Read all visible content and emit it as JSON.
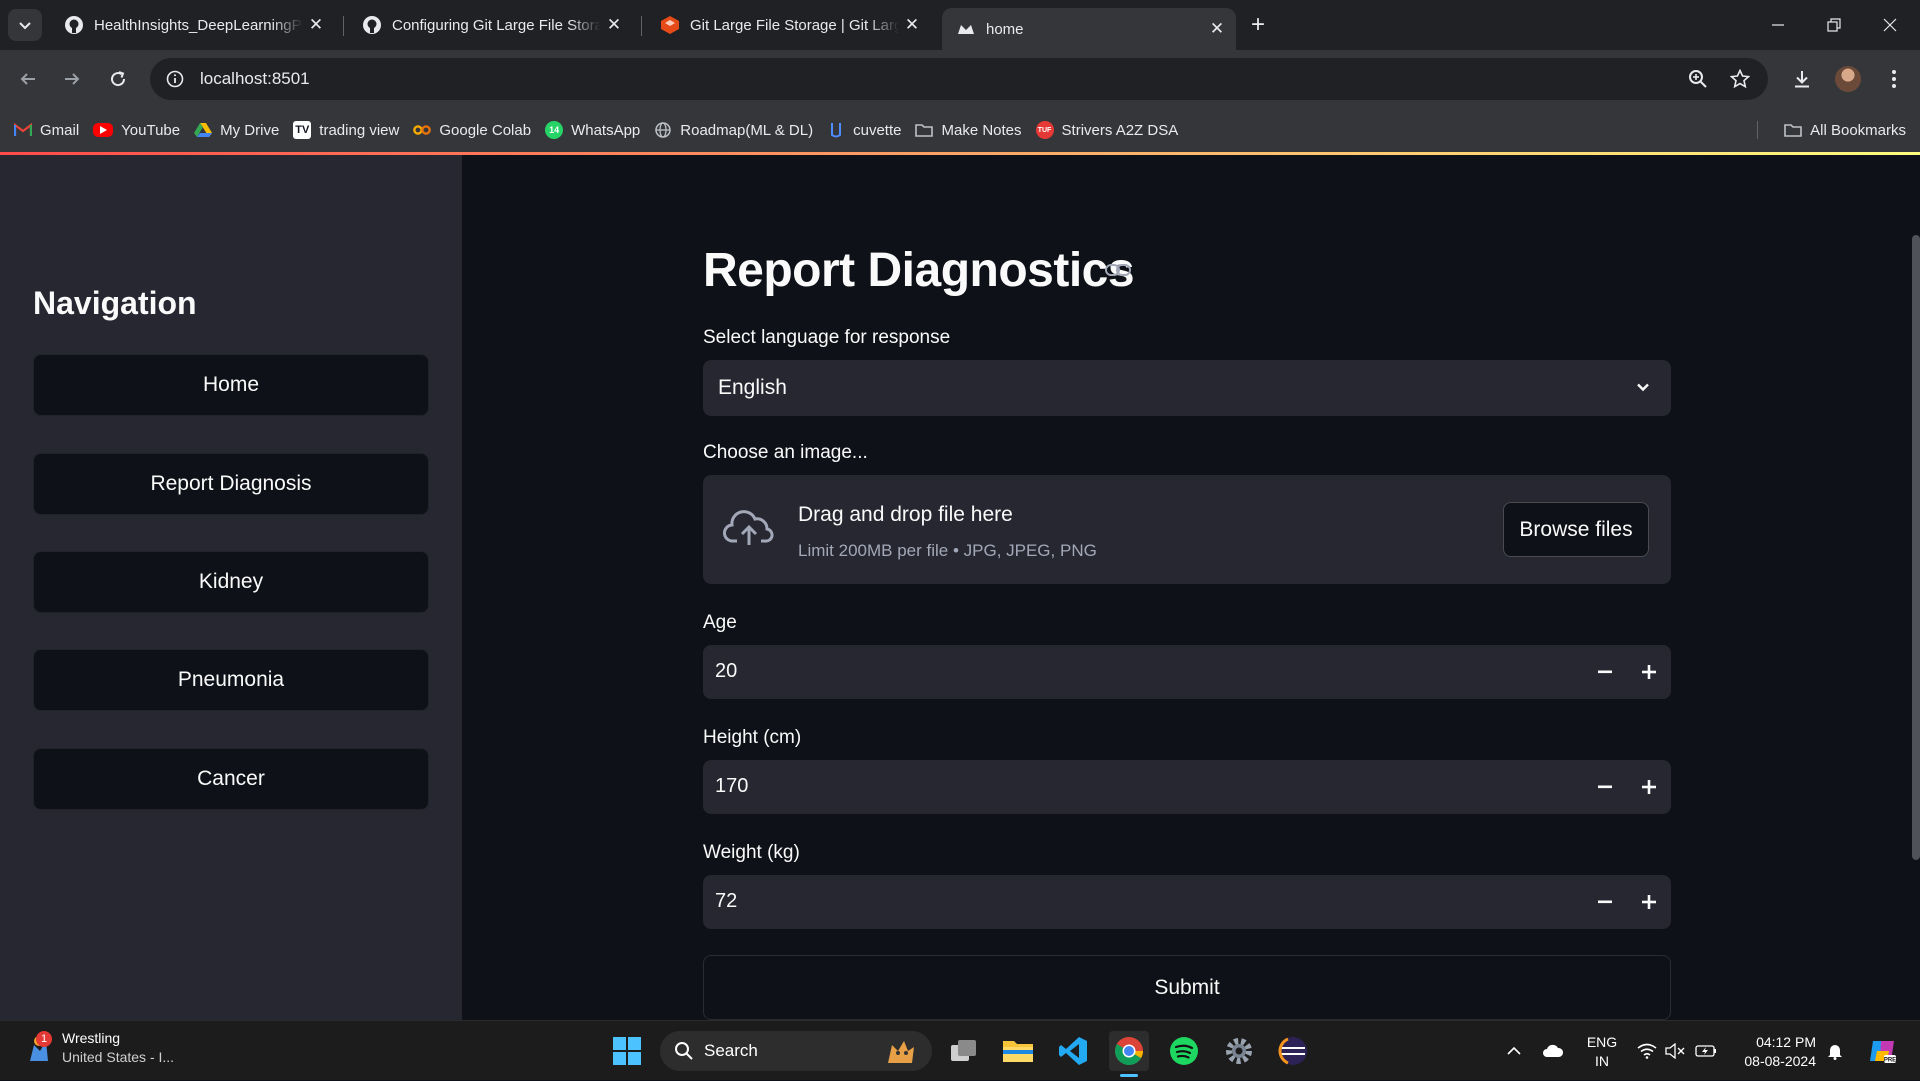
{
  "browser": {
    "tabs": [
      {
        "title": "HealthInsights_DeepLearningPr",
        "icon": "github-icon",
        "active": false
      },
      {
        "title": "Configuring Git Large File Stora",
        "icon": "github-icon",
        "active": false
      },
      {
        "title": "Git Large File Storage | Git Larg",
        "icon": "git-lfs-icon",
        "active": false
      },
      {
        "title": "home",
        "icon": "streamlit-icon",
        "active": true
      }
    ],
    "url": "localhost:8501",
    "bookmarks": [
      {
        "label": "Gmail",
        "icon": "gmail-icon",
        "color": "#ea4335"
      },
      {
        "label": "YouTube",
        "icon": "youtube-icon",
        "color": "#ff0000"
      },
      {
        "label": "My Drive",
        "icon": "drive-icon",
        "color": "#fbbc04"
      },
      {
        "label": "trading view",
        "icon": "tradingview-icon",
        "color": "#ffffff"
      },
      {
        "label": "Google Colab",
        "icon": "colab-icon",
        "color": "#f9ab00"
      },
      {
        "label": "WhatsApp",
        "icon": "whatsapp-icon",
        "color": "#25d366"
      },
      {
        "label": "Roadmap(ML &  DL)",
        "icon": "globe-icon",
        "color": "#bdc1c6"
      },
      {
        "label": "cuvette",
        "icon": "cuvette-icon",
        "color": "#4f8cff"
      },
      {
        "label": "Make Notes",
        "icon": "folder-icon",
        "color": "#bdc1c6"
      },
      {
        "label": "Strivers A2Z DSA",
        "icon": "tuf-icon",
        "color": "#e53935"
      }
    ],
    "all_bookmarks": "All Bookmarks"
  },
  "sidebar": {
    "title": "Navigation",
    "items": [
      {
        "label": "Home"
      },
      {
        "label": "Report Diagnosis"
      },
      {
        "label": "Kidney"
      },
      {
        "label": "Pneumonia"
      },
      {
        "label": "Cancer"
      }
    ]
  },
  "main": {
    "title": "Report Diagnostics",
    "language": {
      "label": "Select language for response",
      "value": "English"
    },
    "uploader": {
      "label": "Choose an image...",
      "drop_text": "Drag and drop file here",
      "limit_text": "Limit 200MB per file • JPG, JPEG, PNG",
      "browse_label": "Browse files"
    },
    "age": {
      "label": "Age",
      "value": "20"
    },
    "height": {
      "label": "Height (cm)",
      "value": "170"
    },
    "weight": {
      "label": "Weight (kg)",
      "value": "72"
    },
    "submit_label": "Submit"
  },
  "taskbar": {
    "weather_title": "Wrestling",
    "weather_sub": "United States - I...",
    "weather_badge": "1",
    "search_placeholder": "Search",
    "lang_line1": "ENG",
    "lang_line2": "IN",
    "time": "04:12 PM",
    "date": "08-08-2024"
  },
  "colors": {
    "app_bg": "#0e1117",
    "sidebar_bg": "#262730",
    "widget_bg": "#262730",
    "accent_gradient_start": "#ff4b4b",
    "accent_gradient_end": "#fffd80"
  }
}
